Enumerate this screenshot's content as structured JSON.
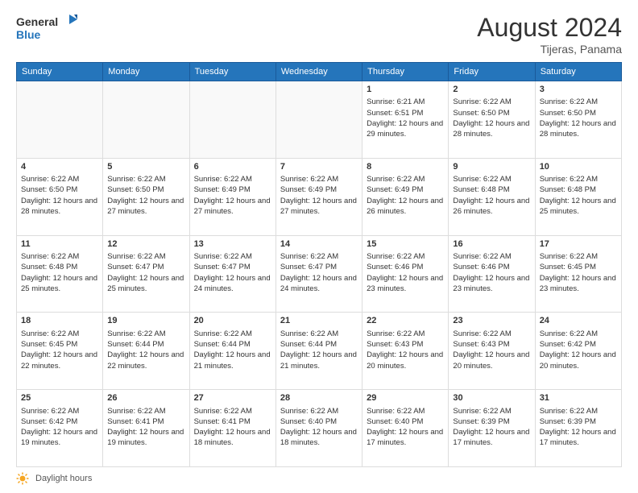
{
  "header": {
    "logo_line1": "General",
    "logo_line2": "Blue",
    "month": "August 2024",
    "location": "Tijeras, Panama"
  },
  "days_of_week": [
    "Sunday",
    "Monday",
    "Tuesday",
    "Wednesday",
    "Thursday",
    "Friday",
    "Saturday"
  ],
  "weeks": [
    [
      {
        "day": "",
        "empty": true
      },
      {
        "day": "",
        "empty": true
      },
      {
        "day": "",
        "empty": true
      },
      {
        "day": "",
        "empty": true
      },
      {
        "day": "1",
        "sunrise": "6:21 AM",
        "sunset": "6:51 PM",
        "daylight": "12 hours and 29 minutes."
      },
      {
        "day": "2",
        "sunrise": "6:22 AM",
        "sunset": "6:50 PM",
        "daylight": "12 hours and 28 minutes."
      },
      {
        "day": "3",
        "sunrise": "6:22 AM",
        "sunset": "6:50 PM",
        "daylight": "12 hours and 28 minutes."
      }
    ],
    [
      {
        "day": "4",
        "sunrise": "6:22 AM",
        "sunset": "6:50 PM",
        "daylight": "12 hours and 28 minutes."
      },
      {
        "day": "5",
        "sunrise": "6:22 AM",
        "sunset": "6:50 PM",
        "daylight": "12 hours and 27 minutes."
      },
      {
        "day": "6",
        "sunrise": "6:22 AM",
        "sunset": "6:49 PM",
        "daylight": "12 hours and 27 minutes."
      },
      {
        "day": "7",
        "sunrise": "6:22 AM",
        "sunset": "6:49 PM",
        "daylight": "12 hours and 27 minutes."
      },
      {
        "day": "8",
        "sunrise": "6:22 AM",
        "sunset": "6:49 PM",
        "daylight": "12 hours and 26 minutes."
      },
      {
        "day": "9",
        "sunrise": "6:22 AM",
        "sunset": "6:48 PM",
        "daylight": "12 hours and 26 minutes."
      },
      {
        "day": "10",
        "sunrise": "6:22 AM",
        "sunset": "6:48 PM",
        "daylight": "12 hours and 25 minutes."
      }
    ],
    [
      {
        "day": "11",
        "sunrise": "6:22 AM",
        "sunset": "6:48 PM",
        "daylight": "12 hours and 25 minutes."
      },
      {
        "day": "12",
        "sunrise": "6:22 AM",
        "sunset": "6:47 PM",
        "daylight": "12 hours and 25 minutes."
      },
      {
        "day": "13",
        "sunrise": "6:22 AM",
        "sunset": "6:47 PM",
        "daylight": "12 hours and 24 minutes."
      },
      {
        "day": "14",
        "sunrise": "6:22 AM",
        "sunset": "6:47 PM",
        "daylight": "12 hours and 24 minutes."
      },
      {
        "day": "15",
        "sunrise": "6:22 AM",
        "sunset": "6:46 PM",
        "daylight": "12 hours and 23 minutes."
      },
      {
        "day": "16",
        "sunrise": "6:22 AM",
        "sunset": "6:46 PM",
        "daylight": "12 hours and 23 minutes."
      },
      {
        "day": "17",
        "sunrise": "6:22 AM",
        "sunset": "6:45 PM",
        "daylight": "12 hours and 23 minutes."
      }
    ],
    [
      {
        "day": "18",
        "sunrise": "6:22 AM",
        "sunset": "6:45 PM",
        "daylight": "12 hours and 22 minutes."
      },
      {
        "day": "19",
        "sunrise": "6:22 AM",
        "sunset": "6:44 PM",
        "daylight": "12 hours and 22 minutes."
      },
      {
        "day": "20",
        "sunrise": "6:22 AM",
        "sunset": "6:44 PM",
        "daylight": "12 hours and 21 minutes."
      },
      {
        "day": "21",
        "sunrise": "6:22 AM",
        "sunset": "6:44 PM",
        "daylight": "12 hours and 21 minutes."
      },
      {
        "day": "22",
        "sunrise": "6:22 AM",
        "sunset": "6:43 PM",
        "daylight": "12 hours and 20 minutes."
      },
      {
        "day": "23",
        "sunrise": "6:22 AM",
        "sunset": "6:43 PM",
        "daylight": "12 hours and 20 minutes."
      },
      {
        "day": "24",
        "sunrise": "6:22 AM",
        "sunset": "6:42 PM",
        "daylight": "12 hours and 20 minutes."
      }
    ],
    [
      {
        "day": "25",
        "sunrise": "6:22 AM",
        "sunset": "6:42 PM",
        "daylight": "12 hours and 19 minutes."
      },
      {
        "day": "26",
        "sunrise": "6:22 AM",
        "sunset": "6:41 PM",
        "daylight": "12 hours and 19 minutes."
      },
      {
        "day": "27",
        "sunrise": "6:22 AM",
        "sunset": "6:41 PM",
        "daylight": "12 hours and 18 minutes."
      },
      {
        "day": "28",
        "sunrise": "6:22 AM",
        "sunset": "6:40 PM",
        "daylight": "12 hours and 18 minutes."
      },
      {
        "day": "29",
        "sunrise": "6:22 AM",
        "sunset": "6:40 PM",
        "daylight": "12 hours and 17 minutes."
      },
      {
        "day": "30",
        "sunrise": "6:22 AM",
        "sunset": "6:39 PM",
        "daylight": "12 hours and 17 minutes."
      },
      {
        "day": "31",
        "sunrise": "6:22 AM",
        "sunset": "6:39 PM",
        "daylight": "12 hours and 17 minutes."
      }
    ]
  ],
  "footer": {
    "label": "Daylight hours"
  }
}
